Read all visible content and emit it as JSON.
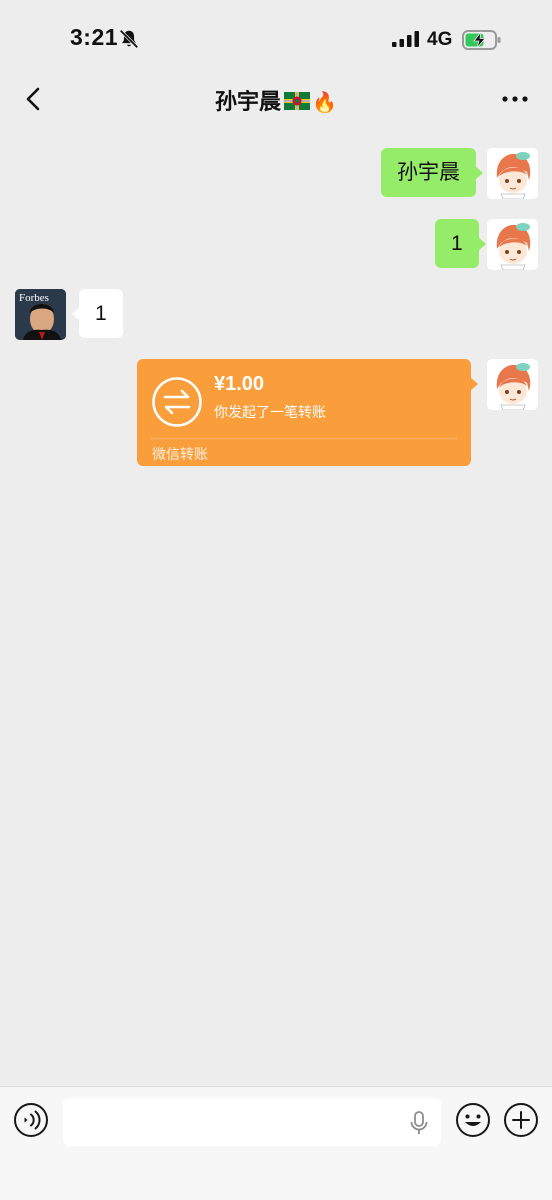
{
  "status_bar": {
    "time": "3:21",
    "network": "4G"
  },
  "nav": {
    "title": "孙宇晨"
  },
  "messages": {
    "m1": {
      "text": "孙宇晨"
    },
    "m2": {
      "text": "1"
    },
    "m3": {
      "text": "1",
      "avatar_text": "Forbes"
    },
    "transfer": {
      "amount": "¥1.00",
      "desc": "你发起了一笔转账",
      "footer": "微信转账"
    }
  },
  "input": {
    "placeholder": ""
  },
  "colors": {
    "self_bubble": "#95ec69",
    "other_bubble": "#ffffff",
    "transfer": "#fa9d3b",
    "background": "#ededed"
  },
  "icons": [
    "bell-slash-icon",
    "signal-icon",
    "battery-charging-icon",
    "back-icon",
    "more-icon",
    "transfer-icon",
    "voice-icon",
    "mic-icon",
    "emoji-icon",
    "plus-icon"
  ]
}
